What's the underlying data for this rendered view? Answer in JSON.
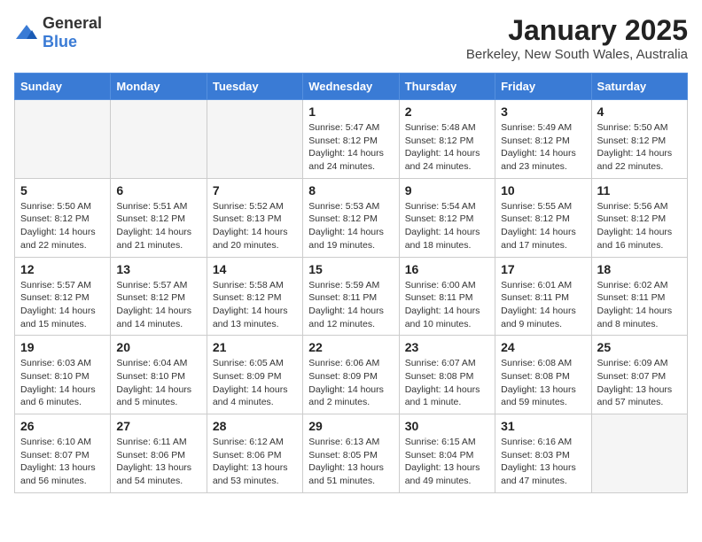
{
  "logo": {
    "general": "General",
    "blue": "Blue"
  },
  "header": {
    "month": "January 2025",
    "location": "Berkeley, New South Wales, Australia"
  },
  "weekdays": [
    "Sunday",
    "Monday",
    "Tuesday",
    "Wednesday",
    "Thursday",
    "Friday",
    "Saturday"
  ],
  "weeks": [
    [
      {
        "day": "",
        "info": ""
      },
      {
        "day": "",
        "info": ""
      },
      {
        "day": "",
        "info": ""
      },
      {
        "day": "1",
        "info": "Sunrise: 5:47 AM\nSunset: 8:12 PM\nDaylight: 14 hours\nand 24 minutes."
      },
      {
        "day": "2",
        "info": "Sunrise: 5:48 AM\nSunset: 8:12 PM\nDaylight: 14 hours\nand 24 minutes."
      },
      {
        "day": "3",
        "info": "Sunrise: 5:49 AM\nSunset: 8:12 PM\nDaylight: 14 hours\nand 23 minutes."
      },
      {
        "day": "4",
        "info": "Sunrise: 5:50 AM\nSunset: 8:12 PM\nDaylight: 14 hours\nand 22 minutes."
      }
    ],
    [
      {
        "day": "5",
        "info": "Sunrise: 5:50 AM\nSunset: 8:12 PM\nDaylight: 14 hours\nand 22 minutes."
      },
      {
        "day": "6",
        "info": "Sunrise: 5:51 AM\nSunset: 8:12 PM\nDaylight: 14 hours\nand 21 minutes."
      },
      {
        "day": "7",
        "info": "Sunrise: 5:52 AM\nSunset: 8:13 PM\nDaylight: 14 hours\nand 20 minutes."
      },
      {
        "day": "8",
        "info": "Sunrise: 5:53 AM\nSunset: 8:12 PM\nDaylight: 14 hours\nand 19 minutes."
      },
      {
        "day": "9",
        "info": "Sunrise: 5:54 AM\nSunset: 8:12 PM\nDaylight: 14 hours\nand 18 minutes."
      },
      {
        "day": "10",
        "info": "Sunrise: 5:55 AM\nSunset: 8:12 PM\nDaylight: 14 hours\nand 17 minutes."
      },
      {
        "day": "11",
        "info": "Sunrise: 5:56 AM\nSunset: 8:12 PM\nDaylight: 14 hours\nand 16 minutes."
      }
    ],
    [
      {
        "day": "12",
        "info": "Sunrise: 5:57 AM\nSunset: 8:12 PM\nDaylight: 14 hours\nand 15 minutes."
      },
      {
        "day": "13",
        "info": "Sunrise: 5:57 AM\nSunset: 8:12 PM\nDaylight: 14 hours\nand 14 minutes."
      },
      {
        "day": "14",
        "info": "Sunrise: 5:58 AM\nSunset: 8:12 PM\nDaylight: 14 hours\nand 13 minutes."
      },
      {
        "day": "15",
        "info": "Sunrise: 5:59 AM\nSunset: 8:11 PM\nDaylight: 14 hours\nand 12 minutes."
      },
      {
        "day": "16",
        "info": "Sunrise: 6:00 AM\nSunset: 8:11 PM\nDaylight: 14 hours\nand 10 minutes."
      },
      {
        "day": "17",
        "info": "Sunrise: 6:01 AM\nSunset: 8:11 PM\nDaylight: 14 hours\nand 9 minutes."
      },
      {
        "day": "18",
        "info": "Sunrise: 6:02 AM\nSunset: 8:11 PM\nDaylight: 14 hours\nand 8 minutes."
      }
    ],
    [
      {
        "day": "19",
        "info": "Sunrise: 6:03 AM\nSunset: 8:10 PM\nDaylight: 14 hours\nand 6 minutes."
      },
      {
        "day": "20",
        "info": "Sunrise: 6:04 AM\nSunset: 8:10 PM\nDaylight: 14 hours\nand 5 minutes."
      },
      {
        "day": "21",
        "info": "Sunrise: 6:05 AM\nSunset: 8:09 PM\nDaylight: 14 hours\nand 4 minutes."
      },
      {
        "day": "22",
        "info": "Sunrise: 6:06 AM\nSunset: 8:09 PM\nDaylight: 14 hours\nand 2 minutes."
      },
      {
        "day": "23",
        "info": "Sunrise: 6:07 AM\nSunset: 8:08 PM\nDaylight: 14 hours\nand 1 minute."
      },
      {
        "day": "24",
        "info": "Sunrise: 6:08 AM\nSunset: 8:08 PM\nDaylight: 13 hours\nand 59 minutes."
      },
      {
        "day": "25",
        "info": "Sunrise: 6:09 AM\nSunset: 8:07 PM\nDaylight: 13 hours\nand 57 minutes."
      }
    ],
    [
      {
        "day": "26",
        "info": "Sunrise: 6:10 AM\nSunset: 8:07 PM\nDaylight: 13 hours\nand 56 minutes."
      },
      {
        "day": "27",
        "info": "Sunrise: 6:11 AM\nSunset: 8:06 PM\nDaylight: 13 hours\nand 54 minutes."
      },
      {
        "day": "28",
        "info": "Sunrise: 6:12 AM\nSunset: 8:06 PM\nDaylight: 13 hours\nand 53 minutes."
      },
      {
        "day": "29",
        "info": "Sunrise: 6:13 AM\nSunset: 8:05 PM\nDaylight: 13 hours\nand 51 minutes."
      },
      {
        "day": "30",
        "info": "Sunrise: 6:15 AM\nSunset: 8:04 PM\nDaylight: 13 hours\nand 49 minutes."
      },
      {
        "day": "31",
        "info": "Sunrise: 6:16 AM\nSunset: 8:03 PM\nDaylight: 13 hours\nand 47 minutes."
      },
      {
        "day": "",
        "info": ""
      }
    ]
  ]
}
